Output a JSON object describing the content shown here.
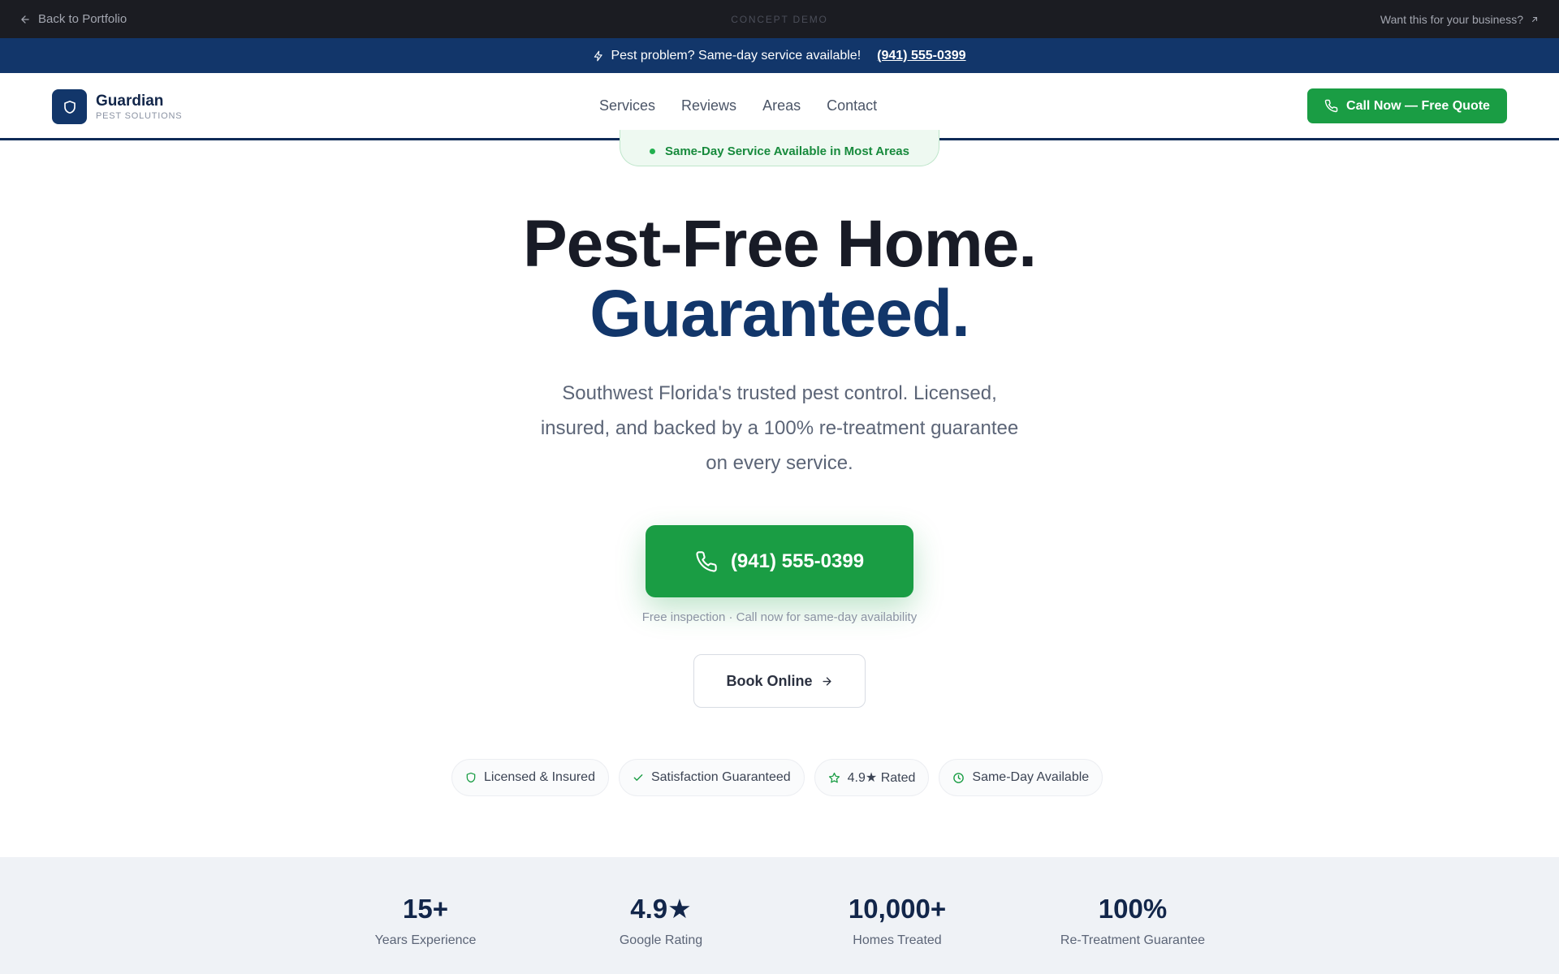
{
  "demo_bar": {
    "back_label": "Back to Portfolio",
    "center_label": "CONCEPT DEMO",
    "right_label": "Want this for your business?"
  },
  "announce": {
    "text": "Pest problem? Same-day service available!",
    "phone": "(941) 555-0399"
  },
  "header": {
    "brand_name": "Guardian",
    "brand_sub": "PEST SOLUTIONS",
    "nav": [
      "Services",
      "Reviews",
      "Areas",
      "Contact"
    ],
    "cta_label": "Call Now — Free Quote"
  },
  "hero": {
    "pill": "Same-Day Service Available in Most Areas",
    "title_line1": "Pest-Free Home.",
    "title_line2": "Guaranteed.",
    "subtitle": "Southwest Florida's trusted pest control. Licensed, insured, and backed by a 100% re-treatment guarantee on every service.",
    "call_label": "(941) 555-0399",
    "note": "Free inspection · Call now for same-day availability",
    "book_label": "Book Online"
  },
  "badges": [
    {
      "label": "Licensed & Insured",
      "icon": "shield-icon"
    },
    {
      "label": "Satisfaction Guaranteed",
      "icon": "check-icon"
    },
    {
      "label": "4.9★ Rated",
      "icon": "star-icon"
    },
    {
      "label": "Same-Day Available",
      "icon": "clock-icon"
    }
  ],
  "stats": [
    {
      "value": "15+",
      "label": "Years Experience"
    },
    {
      "value": "4.9★",
      "label": "Google Rating"
    },
    {
      "value": "10,000+",
      "label": "Homes Treated"
    },
    {
      "value": "100%",
      "label": "Re-Treatment Guarantee"
    }
  ],
  "colors": {
    "brand_navy": "#12366a",
    "brand_green": "#1a9d44",
    "dark_bar": "#1b1c22",
    "stats_bg": "#eff2f6"
  }
}
